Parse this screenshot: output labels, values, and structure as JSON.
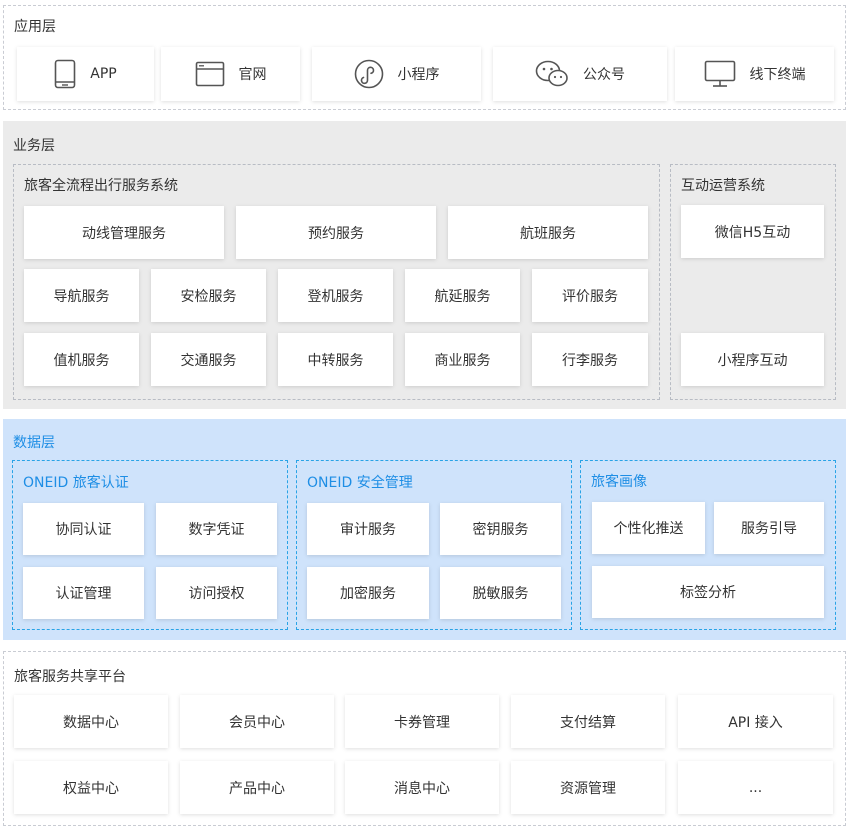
{
  "app_layer": {
    "title": "应用层",
    "items": [
      {
        "label": "APP",
        "icon": "phone-icon"
      },
      {
        "label": "官网",
        "icon": "browser-window-icon"
      },
      {
        "label": "小程序",
        "icon": "mini-program-icon"
      },
      {
        "label": "公众号",
        "icon": "wechat-icon"
      },
      {
        "label": "线下终端",
        "icon": "monitor-icon"
      }
    ]
  },
  "business_layer": {
    "title": "业务层",
    "travel_system": {
      "title": "旅客全流程出行服务系统",
      "row1": [
        "动线管理服务",
        "预约服务",
        "航班服务"
      ],
      "row2": [
        "导航服务",
        "安检服务",
        "登机服务",
        "航延服务",
        "评价服务"
      ],
      "row3": [
        "值机服务",
        "交通服务",
        "中转服务",
        "商业服务",
        "行李服务"
      ]
    },
    "interaction_system": {
      "title": "互动运营系统",
      "items": [
        "微信H5互动",
        "小程序互动"
      ]
    }
  },
  "data_layer": {
    "title": "数据层",
    "oneid_auth": {
      "title": "ONEID 旅客认证",
      "items": [
        "协同认证",
        "数字凭证",
        "认证管理",
        "访问授权"
      ]
    },
    "oneid_security": {
      "title": "ONEID 安全管理",
      "items": [
        "审计服务",
        "密钥服务",
        "加密服务",
        "脱敏服务"
      ]
    },
    "profile": {
      "title": "旅客画像",
      "items": [
        "个性化推送",
        "服务引导",
        "标签分析"
      ]
    }
  },
  "platform_layer": {
    "title": "旅客服务共享平台",
    "row1": [
      "数据中心",
      "会员中心",
      "卡券管理",
      "支付结算",
      "API 接入"
    ],
    "row2": [
      "权益中心",
      "产品中心",
      "消息中心",
      "资源管理",
      "..."
    ]
  },
  "colors": {
    "business_bg": "#ebebeb",
    "data_bg": "#cfe3fb",
    "accent_blue": "#1e8ee5",
    "box_bg": "#ffffff"
  }
}
